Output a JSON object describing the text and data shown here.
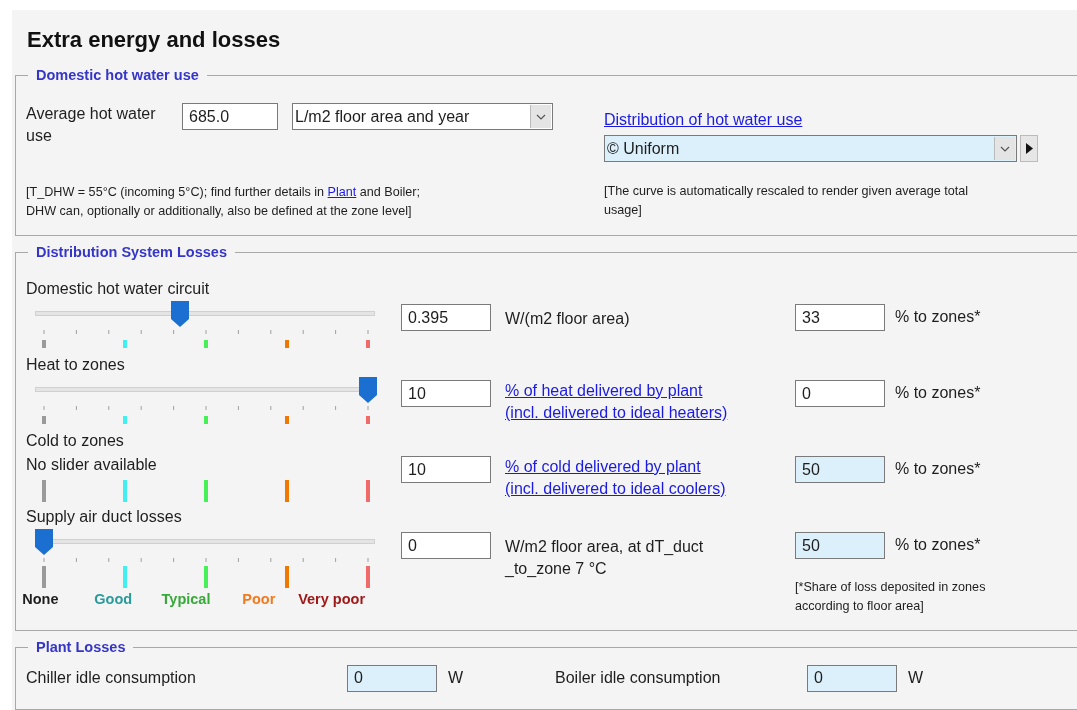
{
  "title": "Extra energy and losses",
  "hot_water": {
    "legend": "Domestic hot water use",
    "label": "Average hot water use",
    "value": "685.0",
    "unit": "L/m2 floor area and year",
    "note": {
      "before": "[T_DHW = 55°C (incoming 5°C); find further details in ",
      "link": "Plant",
      "after": " and Boiler;",
      "second_line": "DHW can, optionally or additionally, also be defined at the zone level]"
    },
    "distribution_link": "Distribution of hot water use",
    "distribution": {
      "value": "© Uniform",
      "highlighted": true
    },
    "distribution_note": "[The curve is automatically rescaled to render given average total usage]"
  },
  "losses": {
    "legend": "Distribution System Losses",
    "rows": [
      {
        "kind": "slider",
        "label": "Domestic hot water circuit",
        "level": 0.42,
        "value": "0.395",
        "unit": "W/(m2 floor area)",
        "unit_is_link": false,
        "share": "33",
        "share_highlighted": false,
        "share_unit": "% to zones*"
      },
      {
        "kind": "slider",
        "label": "Heat to zones",
        "level": 1,
        "value": "10",
        "unit": "% of heat delivered by plant\n(incl. delivered to ideal heaters)",
        "unit_is_link": true,
        "share": "0",
        "share_highlighted": false,
        "share_unit": "% to zones*"
      },
      {
        "kind": "none",
        "label": "Cold to zones",
        "message": "No slider available",
        "value": "10",
        "unit": "% of cold delivered by plant\n(incl. delivered to ideal coolers)",
        "unit_is_link": true,
        "share": "50",
        "share_highlighted": true,
        "share_unit": "% to zones*"
      },
      {
        "kind": "labeled_slider",
        "label": "Supply air duct losses",
        "level": 0,
        "value": "0",
        "unit": "W/m2 floor area, at dT_duct\n_to_zone 7 °C",
        "unit_is_link": false,
        "share": "50",
        "share_highlighted": true,
        "share_unit": "% to zones*"
      }
    ],
    "scale": [
      {
        "label": "None",
        "color": "#1e1e1e",
        "tick": {
          "color": "#9a9a9a"
        }
      },
      {
        "label": "Good",
        "color": "#2a9a9a",
        "tick": {
          "color": "#40f0f0"
        }
      },
      {
        "label": "Typical",
        "color": "#38a838",
        "tick": {
          "color": "#48f058"
        }
      },
      {
        "label": "Poor",
        "color": "#f07a1e",
        "tick": {
          "color": "#f07800"
        }
      },
      {
        "label": "Very poor",
        "color": "#a01818",
        "tick": {
          "color": "#f06a6a"
        }
      }
    ],
    "footnote": "[*Share of loss deposited in zones according to floor area]"
  },
  "plant": {
    "legend": "Plant Losses",
    "items": [
      {
        "label": "Chiller idle consumption",
        "value": "0",
        "unit": "W",
        "highlighted": true
      },
      {
        "label": "Boiler idle consumption",
        "value": "0",
        "unit": "W",
        "highlighted": true
      }
    ]
  }
}
